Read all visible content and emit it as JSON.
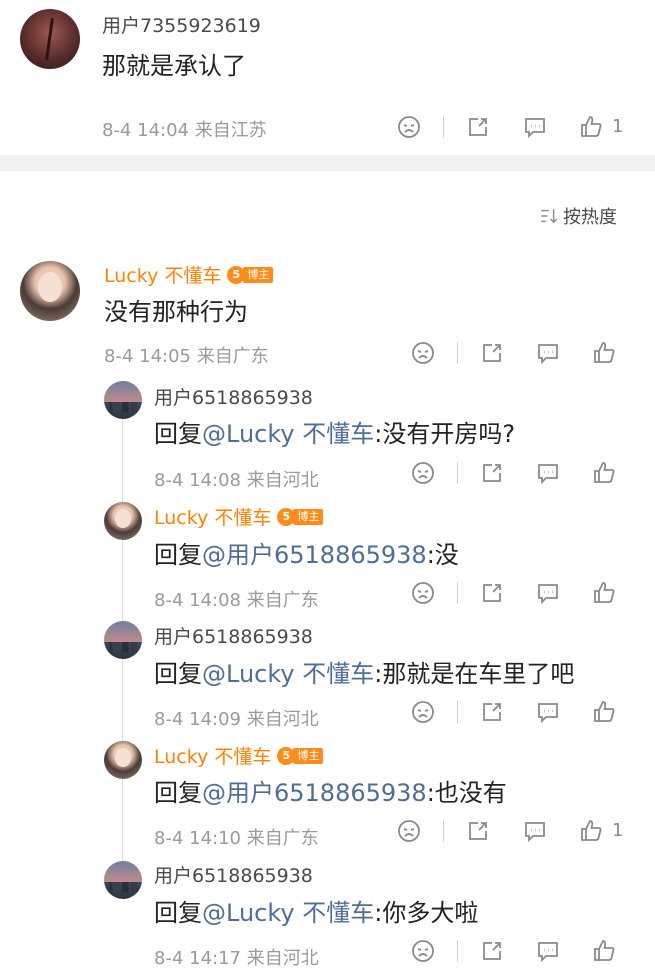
{
  "top_comment": {
    "username": "用户7355923619",
    "text": "那就是承认了",
    "meta": "8-4 14:04 来自江苏",
    "likes": "1"
  },
  "sort_label": "按热度",
  "main_comment": {
    "username": "Lucky 不懂车",
    "badge_level": "5",
    "badge_text": "博主",
    "text": "没有那种行为",
    "meta": "8-4 14:05 来自广东"
  },
  "replies": [
    {
      "username": "用户6518865938",
      "prefix": "回复",
      "mention": "@Lucky 不懂车",
      "rest": ":没有开房吗?",
      "meta": "8-4 14:08 来自河北",
      "likes": ""
    },
    {
      "username": "Lucky 不懂车",
      "badge_level": "5",
      "badge_text": "博主",
      "prefix": "回复",
      "mention": "@用户6518865938",
      "rest": ":没",
      "meta": "8-4 14:08 来自广东",
      "likes": ""
    },
    {
      "username": "用户6518865938",
      "prefix": "回复",
      "mention": "@Lucky 不懂车",
      "rest": ":那就是在车里了吧",
      "meta": "8-4 14:09 来自河北",
      "likes": ""
    },
    {
      "username": "Lucky 不懂车",
      "badge_level": "5",
      "badge_text": "博主",
      "prefix": "回复",
      "mention": "@用户6518865938",
      "rest": ":也没有",
      "meta": "8-4 14:10 来自广东",
      "likes": "1"
    },
    {
      "username": "用户6518865938",
      "prefix": "回复",
      "mention": "@Lucky 不懂车",
      "rest": ":你多大啦",
      "meta": "8-4 14:17 来自河北",
      "likes": ""
    }
  ],
  "colors": {
    "author": "#ff8200",
    "mention": "#4e6d99",
    "meta": "#9a9a9a"
  },
  "icons": [
    "dislike-face-icon",
    "share-icon",
    "comment-icon",
    "like-thumb-icon",
    "sort-icon"
  ]
}
